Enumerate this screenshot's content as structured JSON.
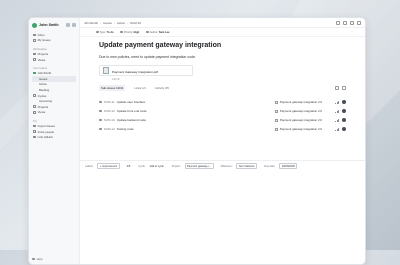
{
  "workspace": {
    "name": "John Smith"
  },
  "sidebar": {
    "top_items": [
      {
        "label": "Inbox",
        "icon": "inbox-icon"
      },
      {
        "label": "My issues",
        "icon": "user-icon"
      }
    ],
    "workspace_heading": "Workspace",
    "workspace_items": [
      {
        "label": "Projects",
        "icon": "box-icon"
      },
      {
        "label": "Views",
        "icon": "layers-icon"
      }
    ],
    "teams_heading": "Your teams",
    "team_name": "JohnSmith",
    "team_items": [
      {
        "label": "Issues"
      },
      {
        "label": "Active"
      },
      {
        "label": "Backlog"
      },
      {
        "label": "Cycles"
      },
      {
        "label": "Upcoming"
      },
      {
        "label": "Projects"
      },
      {
        "label": "Views"
      }
    ],
    "try_heading": "Try",
    "try_items": [
      {
        "label": "Import issues",
        "icon": "download-icon"
      },
      {
        "label": "Invite people",
        "icon": "plus-icon"
      },
      {
        "label": "Link GitHub",
        "icon": "github-icon"
      }
    ],
    "help_label": "Help"
  },
  "breadcrumb": [
    "JohnSmith",
    "Issues",
    "Active",
    "SUM-10"
  ],
  "properties": {
    "type_label": "Type:",
    "type_value": "To do",
    "priority_label": "Priority:",
    "priority_value": "High",
    "assignee_label": "Author:",
    "assignee_value": "Sam Lee"
  },
  "issue": {
    "title": "Update payment gateway integration",
    "description": "Due to new policies, need to update payment integration code.",
    "attachment_name": "Payment Gateway Integration.pdf",
    "attachment_size": "240 kB"
  },
  "tabs": {
    "items": [
      "Sub-issues 10/41",
      "Links 1/1",
      "Activity 3/5"
    ]
  },
  "tasks": [
    {
      "id": "SUM-11",
      "title": "Update user interface",
      "project": "Payment gateway integration 2.0",
      "bars": [
        1,
        2,
        3
      ]
    },
    {
      "id": "SUM-12",
      "title": "Update front end code",
      "project": "Payment gateway integration 2.0",
      "bars": [
        1,
        2,
        3
      ]
    },
    {
      "id": "SUM-13",
      "title": "Update backend code",
      "project": "Payment gateway integration 2.0",
      "bars": [
        1,
        2,
        3
      ]
    },
    {
      "id": "SUM-14",
      "title": "Testing code",
      "project": "Payment gateway integration 2.0",
      "bars": [
        1,
        2,
        3
      ]
    }
  ],
  "footer": {
    "labels_label": "Labels:",
    "labels_value": "+ Improvement",
    "estimate": "0/5",
    "cycle_label": "Cycle:",
    "cycle_value": "Add to cycle",
    "project_label": "Project:",
    "project_value": "Payment gateway i...",
    "milestone_label": "Milestone:",
    "milestone_value": "Set milestone",
    "due_label": "Due date:",
    "due_value": "03/09/2025"
  }
}
